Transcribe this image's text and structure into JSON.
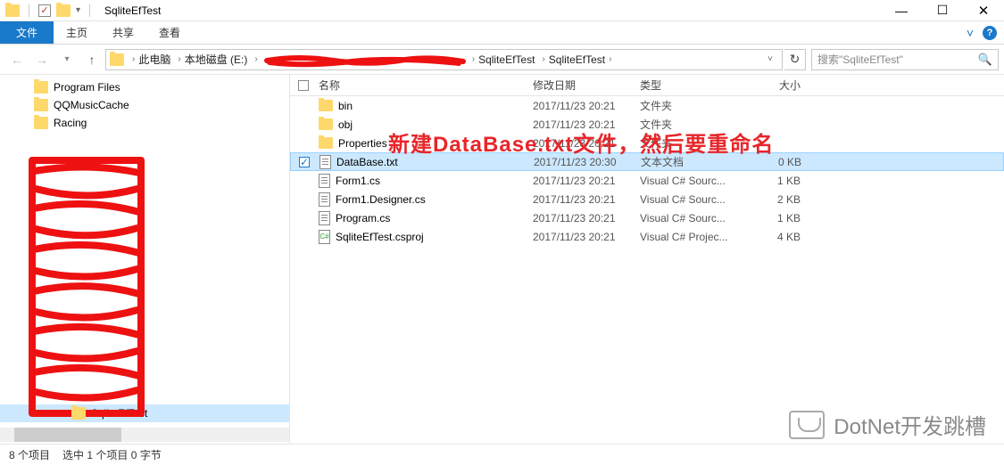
{
  "window": {
    "title": "SqliteEfTest",
    "controls": {
      "min": "—",
      "max": "☐",
      "close": "✕"
    }
  },
  "ribbon": {
    "file": "文件",
    "tabs": [
      "主页",
      "共享",
      "查看"
    ],
    "expand": "˅"
  },
  "breadcrumb": {
    "items": [
      "此电脑",
      "本地磁盘 (E:)",
      "",
      "SqliteEfTest",
      "SqliteEfTest"
    ],
    "refresh": "↻",
    "search_placeholder": "搜索\"SqliteEfTest\""
  },
  "tree": {
    "items": [
      "Program Files",
      "QQMusicCache",
      "Racing"
    ],
    "selected": "SqliteEfTest"
  },
  "columns": {
    "name": "名称",
    "date": "修改日期",
    "type": "类型",
    "size": "大小"
  },
  "files": [
    {
      "icon": "folder",
      "name": "bin",
      "date": "2017/11/23 20:21",
      "type": "文件夹",
      "size": "",
      "selected": false
    },
    {
      "icon": "folder",
      "name": "obj",
      "date": "2017/11/23 20:21",
      "type": "文件夹",
      "size": "",
      "selected": false
    },
    {
      "icon": "folder",
      "name": "Properties",
      "date": "2017/11/23 20:21",
      "type": "文件夹",
      "size": "",
      "selected": false
    },
    {
      "icon": "txt",
      "name": "DataBase.txt",
      "date": "2017/11/23 20:30",
      "type": "文本文档",
      "size": "0 KB",
      "selected": true
    },
    {
      "icon": "txt",
      "name": "Form1.cs",
      "date": "2017/11/23 20:21",
      "type": "Visual C# Sourc...",
      "size": "1 KB",
      "selected": false
    },
    {
      "icon": "txt",
      "name": "Form1.Designer.cs",
      "date": "2017/11/23 20:21",
      "type": "Visual C# Sourc...",
      "size": "2 KB",
      "selected": false
    },
    {
      "icon": "txt",
      "name": "Program.cs",
      "date": "2017/11/23 20:21",
      "type": "Visual C# Sourc...",
      "size": "1 KB",
      "selected": false
    },
    {
      "icon": "cs",
      "name": "SqliteEfTest.csproj",
      "date": "2017/11/23 20:21",
      "type": "Visual C# Projec...",
      "size": "4 KB",
      "selected": false
    }
  ],
  "annotation": "新建DataBase.txt文件，然后要重命名",
  "status": {
    "count": "8 个项目",
    "selection": "选中 1 个项目 0 字节"
  },
  "watermark": "DotNet开发跳槽"
}
